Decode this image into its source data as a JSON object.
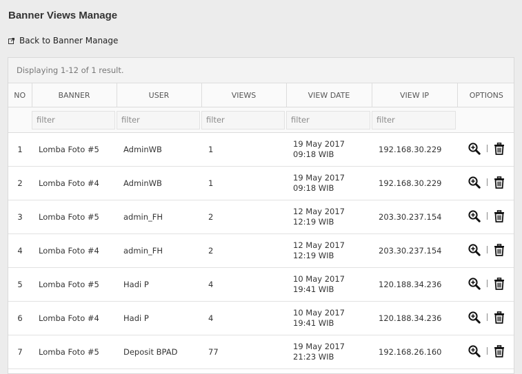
{
  "header": {
    "title": "Banner Views Manage",
    "back_label": "Back to Banner Manage"
  },
  "grid": {
    "summary": "Displaying 1-12 of 1 result.",
    "columns": [
      "NO",
      "BANNER",
      "USER",
      "VIEWS",
      "VIEW DATE",
      "VIEW IP",
      "OPTIONS"
    ],
    "filter_placeholder": "filter",
    "rows": [
      {
        "no": "1",
        "banner": "Lomba Foto #5",
        "user": "AdminWB",
        "views": "1",
        "date": "19 May 2017",
        "time": "09:18 WIB",
        "ip": "192.168.30.229"
      },
      {
        "no": "2",
        "banner": "Lomba Foto #4",
        "user": "AdminWB",
        "views": "1",
        "date": "19 May 2017",
        "time": "09:18 WIB",
        "ip": "192.168.30.229"
      },
      {
        "no": "3",
        "banner": "Lomba Foto #5",
        "user": "admin_FH",
        "views": "2",
        "date": "12 May 2017",
        "time": "12:19 WIB",
        "ip": "203.30.237.154"
      },
      {
        "no": "4",
        "banner": "Lomba Foto #4",
        "user": "admin_FH",
        "views": "2",
        "date": "12 May 2017",
        "time": "12:19 WIB",
        "ip": "203.30.237.154"
      },
      {
        "no": "5",
        "banner": "Lomba Foto #5",
        "user": "Hadi P",
        "views": "4",
        "date": "10 May 2017",
        "time": "19:41 WIB",
        "ip": "120.188.34.236"
      },
      {
        "no": "6",
        "banner": "Lomba Foto #4",
        "user": "Hadi P",
        "views": "4",
        "date": "10 May 2017",
        "time": "19:41 WIB",
        "ip": "120.188.34.236"
      },
      {
        "no": "7",
        "banner": "Lomba Foto #5",
        "user": "Deposit BPAD",
        "views": "77",
        "date": "19 May 2017",
        "time": "21:23 WIB",
        "ip": "192.168.26.160"
      }
    ]
  },
  "icons": {
    "back": "external-link-icon",
    "view": "zoom-in-icon",
    "delete": "trash-icon"
  },
  "colors": {
    "page_background": "#ececec",
    "panel_background": "#ffffff",
    "border": "#dcdcdc",
    "text": "#333333"
  }
}
